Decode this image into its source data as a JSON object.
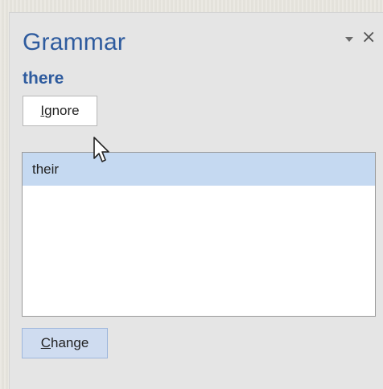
{
  "pane": {
    "title": "Grammar",
    "error_word": "there"
  },
  "buttons": {
    "ignore": {
      "accel": "I",
      "rest": "gnore"
    },
    "change": {
      "accel": "C",
      "rest": "hange"
    }
  },
  "suggestions": [
    {
      "text": "their",
      "selected": true
    }
  ],
  "icons": {
    "menu": "chevron-down-icon",
    "close": "close-icon",
    "pointer": "mouse-pointer-icon"
  },
  "colors": {
    "title": "#2e5b9e",
    "selection": "#c5d9f1",
    "pane_bg": "#e5e5e5"
  }
}
